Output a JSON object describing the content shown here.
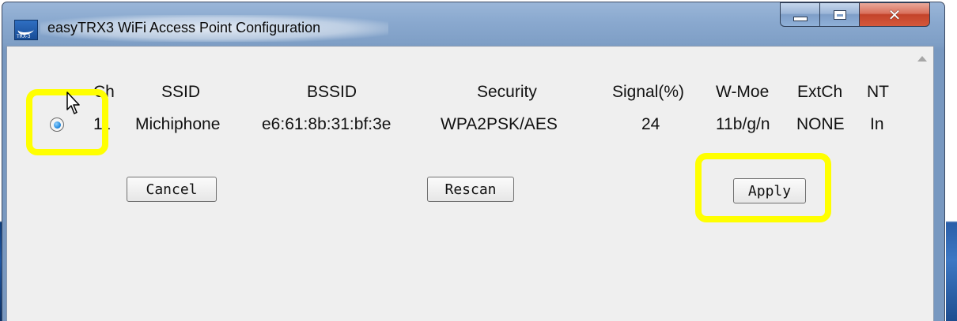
{
  "window": {
    "title": "easyTRX3 WiFi Access Point Configuration",
    "app_icon_text": "TRX-3"
  },
  "table": {
    "headers": [
      "Ch",
      "SSID",
      "BSSID",
      "Security",
      "Signal(%)",
      "W-Moe",
      "ExtCh",
      "NT"
    ],
    "rows": [
      {
        "selected": true,
        "ch": "11",
        "ssid": "Michiphone",
        "bssid": "e6:61:8b:31:bf:3e",
        "security": "WPA2PSK/AES",
        "signal": "24",
        "wmode": "11b/g/n",
        "extch": "NONE",
        "nt": "In"
      }
    ]
  },
  "buttons": {
    "cancel": "Cancel",
    "rescan": "Rescan",
    "apply": "Apply"
  },
  "colors": {
    "highlight": "#ffff00",
    "client_bg": "#efefef",
    "radio_selected": "#2a8ee0"
  }
}
